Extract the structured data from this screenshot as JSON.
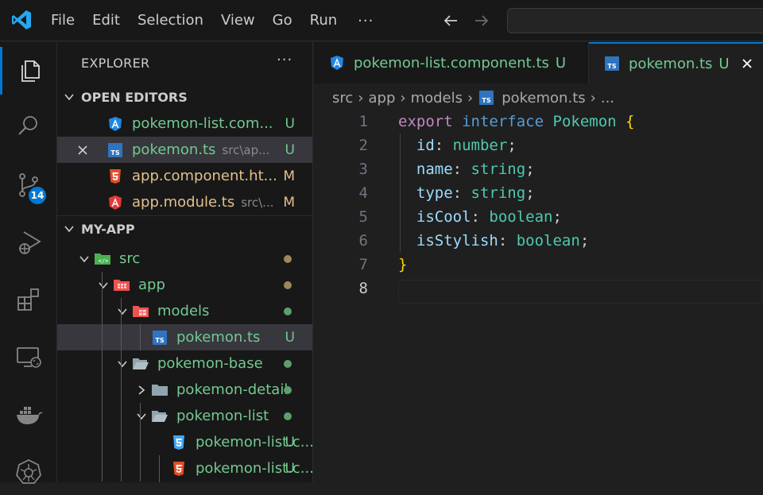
{
  "menu": [
    "File",
    "Edit",
    "Selection",
    "View",
    "Go",
    "Run"
  ],
  "menu_more": "···",
  "activity": {
    "source_control_badge": "14"
  },
  "sidebar": {
    "title": "EXPLORER",
    "more": "···",
    "open_editors_header": "OPEN EDITORS",
    "open_editors": [
      {
        "name": "pokemon-list.com...",
        "desc": "",
        "status": "U",
        "color": "#73c991",
        "icon": "angular-icon"
      },
      {
        "name": "pokemon.ts",
        "desc": "src\\ap...",
        "status": "U",
        "color": "#73c991",
        "icon": "typescript-icon"
      },
      {
        "name": "app.component.ht...",
        "desc": "",
        "status": "M",
        "color": "#e2c08d",
        "icon": "html-icon"
      },
      {
        "name": "app.module.ts",
        "desc": "src\\...",
        "status": "M",
        "color": "#e2c08d",
        "icon": "angular-module-icon"
      }
    ],
    "project_header": "MY-APP",
    "tree": [
      {
        "name": "src",
        "depth": 0,
        "chevron": "down",
        "icon": "src-folder-icon"
      },
      {
        "name": "app",
        "depth": 1,
        "chevron": "down",
        "icon": "app-folder-icon"
      },
      {
        "name": "models",
        "depth": 2,
        "chevron": "down",
        "icon": "models-folder-icon"
      },
      {
        "name": "pokemon.ts",
        "depth": 3,
        "chevron": "none",
        "icon": "typescript-icon",
        "status": "U"
      },
      {
        "name": "pokemon-base",
        "depth": 2,
        "chevron": "down",
        "icon": "folder-open-icon"
      },
      {
        "name": "pokemon-detail",
        "depth": 3,
        "chevron": "right",
        "icon": "folder-icon"
      },
      {
        "name": "pokemon-list",
        "depth": 3,
        "chevron": "down",
        "icon": "folder-open-icon"
      },
      {
        "name": "pokemon-list.c...",
        "depth": 4,
        "chevron": "none",
        "icon": "css-icon",
        "status": "U"
      },
      {
        "name": "pokemon-list.c...",
        "depth": 4,
        "chevron": "none",
        "icon": "html-icon",
        "status": "U"
      }
    ]
  },
  "tabs": [
    {
      "label": "pokemon-list.component.ts",
      "status": "U",
      "icon": "angular-icon"
    },
    {
      "label": "pokemon.ts",
      "status": "U",
      "icon": "typescript-icon"
    }
  ],
  "breadcrumb": [
    "src",
    "app",
    "models",
    "pokemon.ts",
    "..."
  ],
  "editor": {
    "line_numbers": [
      "1",
      "2",
      "3",
      "4",
      "5",
      "6",
      "7",
      "8"
    ],
    "lines": [
      [
        [
          "k",
          "export"
        ],
        [
          "pu",
          " "
        ],
        [
          "kw",
          "interface"
        ],
        [
          "pu",
          " "
        ],
        [
          "ty",
          "Pokemon"
        ],
        [
          "pu",
          " "
        ],
        [
          "br",
          "{"
        ]
      ],
      [
        [
          "pu",
          "  "
        ],
        [
          "pr",
          "id"
        ],
        [
          "pu",
          ": "
        ],
        [
          "ty",
          "number"
        ],
        [
          "pu",
          ";"
        ]
      ],
      [
        [
          "pu",
          "  "
        ],
        [
          "pr",
          "name"
        ],
        [
          "pu",
          ": "
        ],
        [
          "ty",
          "string"
        ],
        [
          "pu",
          ";"
        ]
      ],
      [
        [
          "pu",
          "  "
        ],
        [
          "pr",
          "type"
        ],
        [
          "pu",
          ": "
        ],
        [
          "ty",
          "string"
        ],
        [
          "pu",
          ";"
        ]
      ],
      [
        [
          "pu",
          "  "
        ],
        [
          "pr",
          "isCool"
        ],
        [
          "pu",
          ": "
        ],
        [
          "ty",
          "boolean"
        ],
        [
          "pu",
          ";"
        ]
      ],
      [
        [
          "pu",
          "  "
        ],
        [
          "pr",
          "isStylish"
        ],
        [
          "pu",
          ": "
        ],
        [
          "ty",
          "boolean"
        ],
        [
          "pu",
          ";"
        ]
      ],
      [
        [
          "br",
          "}"
        ]
      ],
      []
    ]
  },
  "colors": {
    "untracked": "#73c991",
    "modified": "#e2c08d",
    "accent": "#0078d4"
  }
}
